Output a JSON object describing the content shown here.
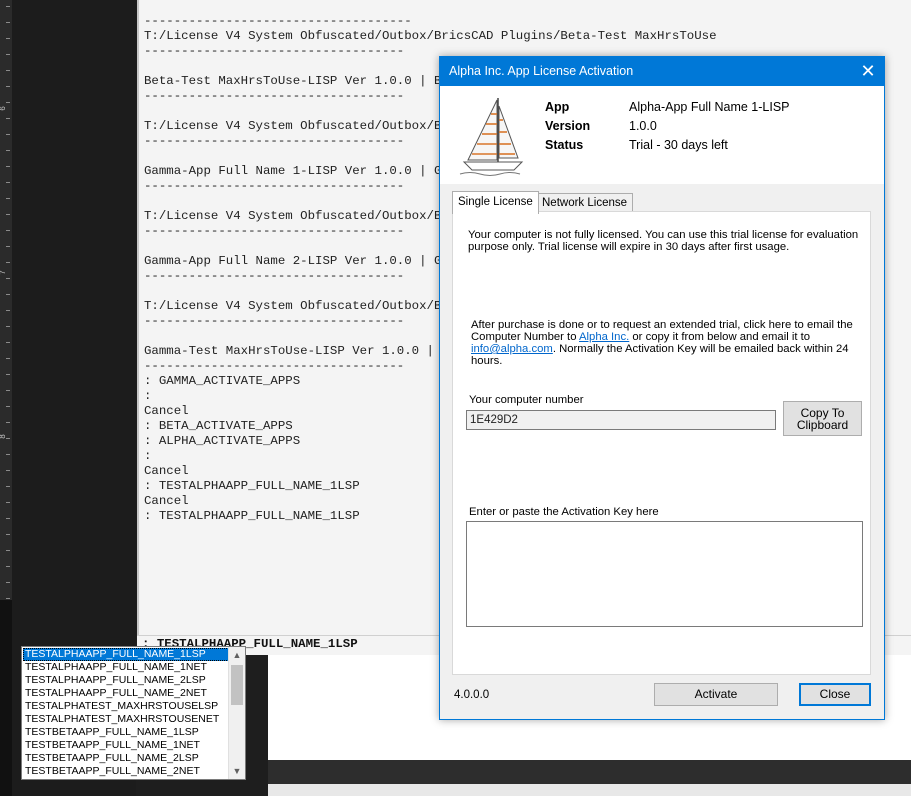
{
  "ruler": {
    "labels": [
      "6",
      "7",
      "8"
    ]
  },
  "console": {
    "lines": [
      "------------------------------------",
      "T:/License V4 System Obfuscated/Outbox/BricsCAD Plugins/Beta-Test MaxHrsToUse",
      "-----------------------------------",
      "",
      "Beta-Test MaxHrsToUse-LISP Ver 1.0.0 | Beta",
      "-----------------------------------",
      "",
      "T:/License V4 System Obfuscated/Outbox/Bric",
      "-----------------------------------",
      "",
      "Gamma-App Full Name 1-LISP Ver 1.0.0 | Gamm",
      "-----------------------------------",
      "",
      "T:/License V4 System Obfuscated/Outbox/Bric",
      "-----------------------------------",
      "",
      "Gamma-App Full Name 2-LISP Ver 1.0.0 | Gamm",
      "-----------------------------------",
      "",
      "T:/License V4 System Obfuscated/Outbox/Bric",
      "-----------------------------------",
      "",
      "Gamma-Test MaxHrsToUse-LISP Ver 1.0.0 | Gam",
      "-----------------------------------",
      ": GAMMA_ACTIVATE_APPS",
      ":",
      "Cancel",
      ": BETA_ACTIVATE_APPS",
      ": ALPHA_ACTIVATE_APPS",
      ":",
      "Cancel",
      ": TESTALPHAAPP_FULL_NAME_1LSP",
      "Cancel",
      ": TESTALPHAAPP_FULL_NAME_1LSP"
    ],
    "command_input": ": TESTALPHAAPP_FULL_NAME_1LSP"
  },
  "autocomplete": {
    "items": [
      "TESTALPHAAPP_FULL_NAME_1LSP",
      "TESTALPHAAPP_FULL_NAME_1NET",
      "TESTALPHAAPP_FULL_NAME_2LSP",
      "TESTALPHAAPP_FULL_NAME_2NET",
      "TESTALPHATEST_MAXHRSTOUSELSP",
      "TESTALPHATEST_MAXHRSTOUSENET",
      "TESTBETAAPP_FULL_NAME_1LSP",
      "TESTBETAAPP_FULL_NAME_1NET",
      "TESTBETAAPP_FULL_NAME_2LSP",
      "TESTBETAAPP_FULL_NAME_2NET"
    ],
    "selected_index": 0,
    "scroll_up_icon": "chevron-up-icon",
    "scroll_down_icon": "chevron-down-icon"
  },
  "dialog": {
    "title": "Alpha Inc. App License Activation",
    "close_glyph": "✕",
    "icon": "sailboat-icon",
    "info": {
      "app_label": "App",
      "app_value": "Alpha-App Full Name 1-LISP",
      "version_label": "Version",
      "version_value": "1.0.0",
      "status_label": "Status",
      "status_value": "Trial - 30 days left"
    },
    "tabs": [
      "Single License",
      "Network License"
    ],
    "active_tab": 0,
    "panel": {
      "notice_line1": "Your computer is not fully licensed. You can use this trial license for evaluation",
      "notice_line2": "purpose only. Trial license will expire in 30 days after first usage.",
      "purchase_line1": "After purchase is done or to request an extended trial, click here to email the",
      "purchase_line2_a": "Computer Number to ",
      "purchase_link1": "Alpha Inc.",
      "purchase_line2_b": " or copy it from below and email it to",
      "purchase_link2": "info@alpha.com",
      "purchase_line3_b": ". Normally the Activation Key will be emailed back within 24",
      "purchase_line4": "hours.",
      "computer_number_label": "Your computer number",
      "computer_number_value": "1E429D2",
      "copy_button_line1": "Copy To",
      "copy_button_line2": "Clipboard",
      "activation_key_label": "Enter or paste the Activation Key here",
      "activation_key_value": ""
    },
    "version_text": "4.0.0.0",
    "activate_button": "Activate",
    "close_button": "Close"
  }
}
